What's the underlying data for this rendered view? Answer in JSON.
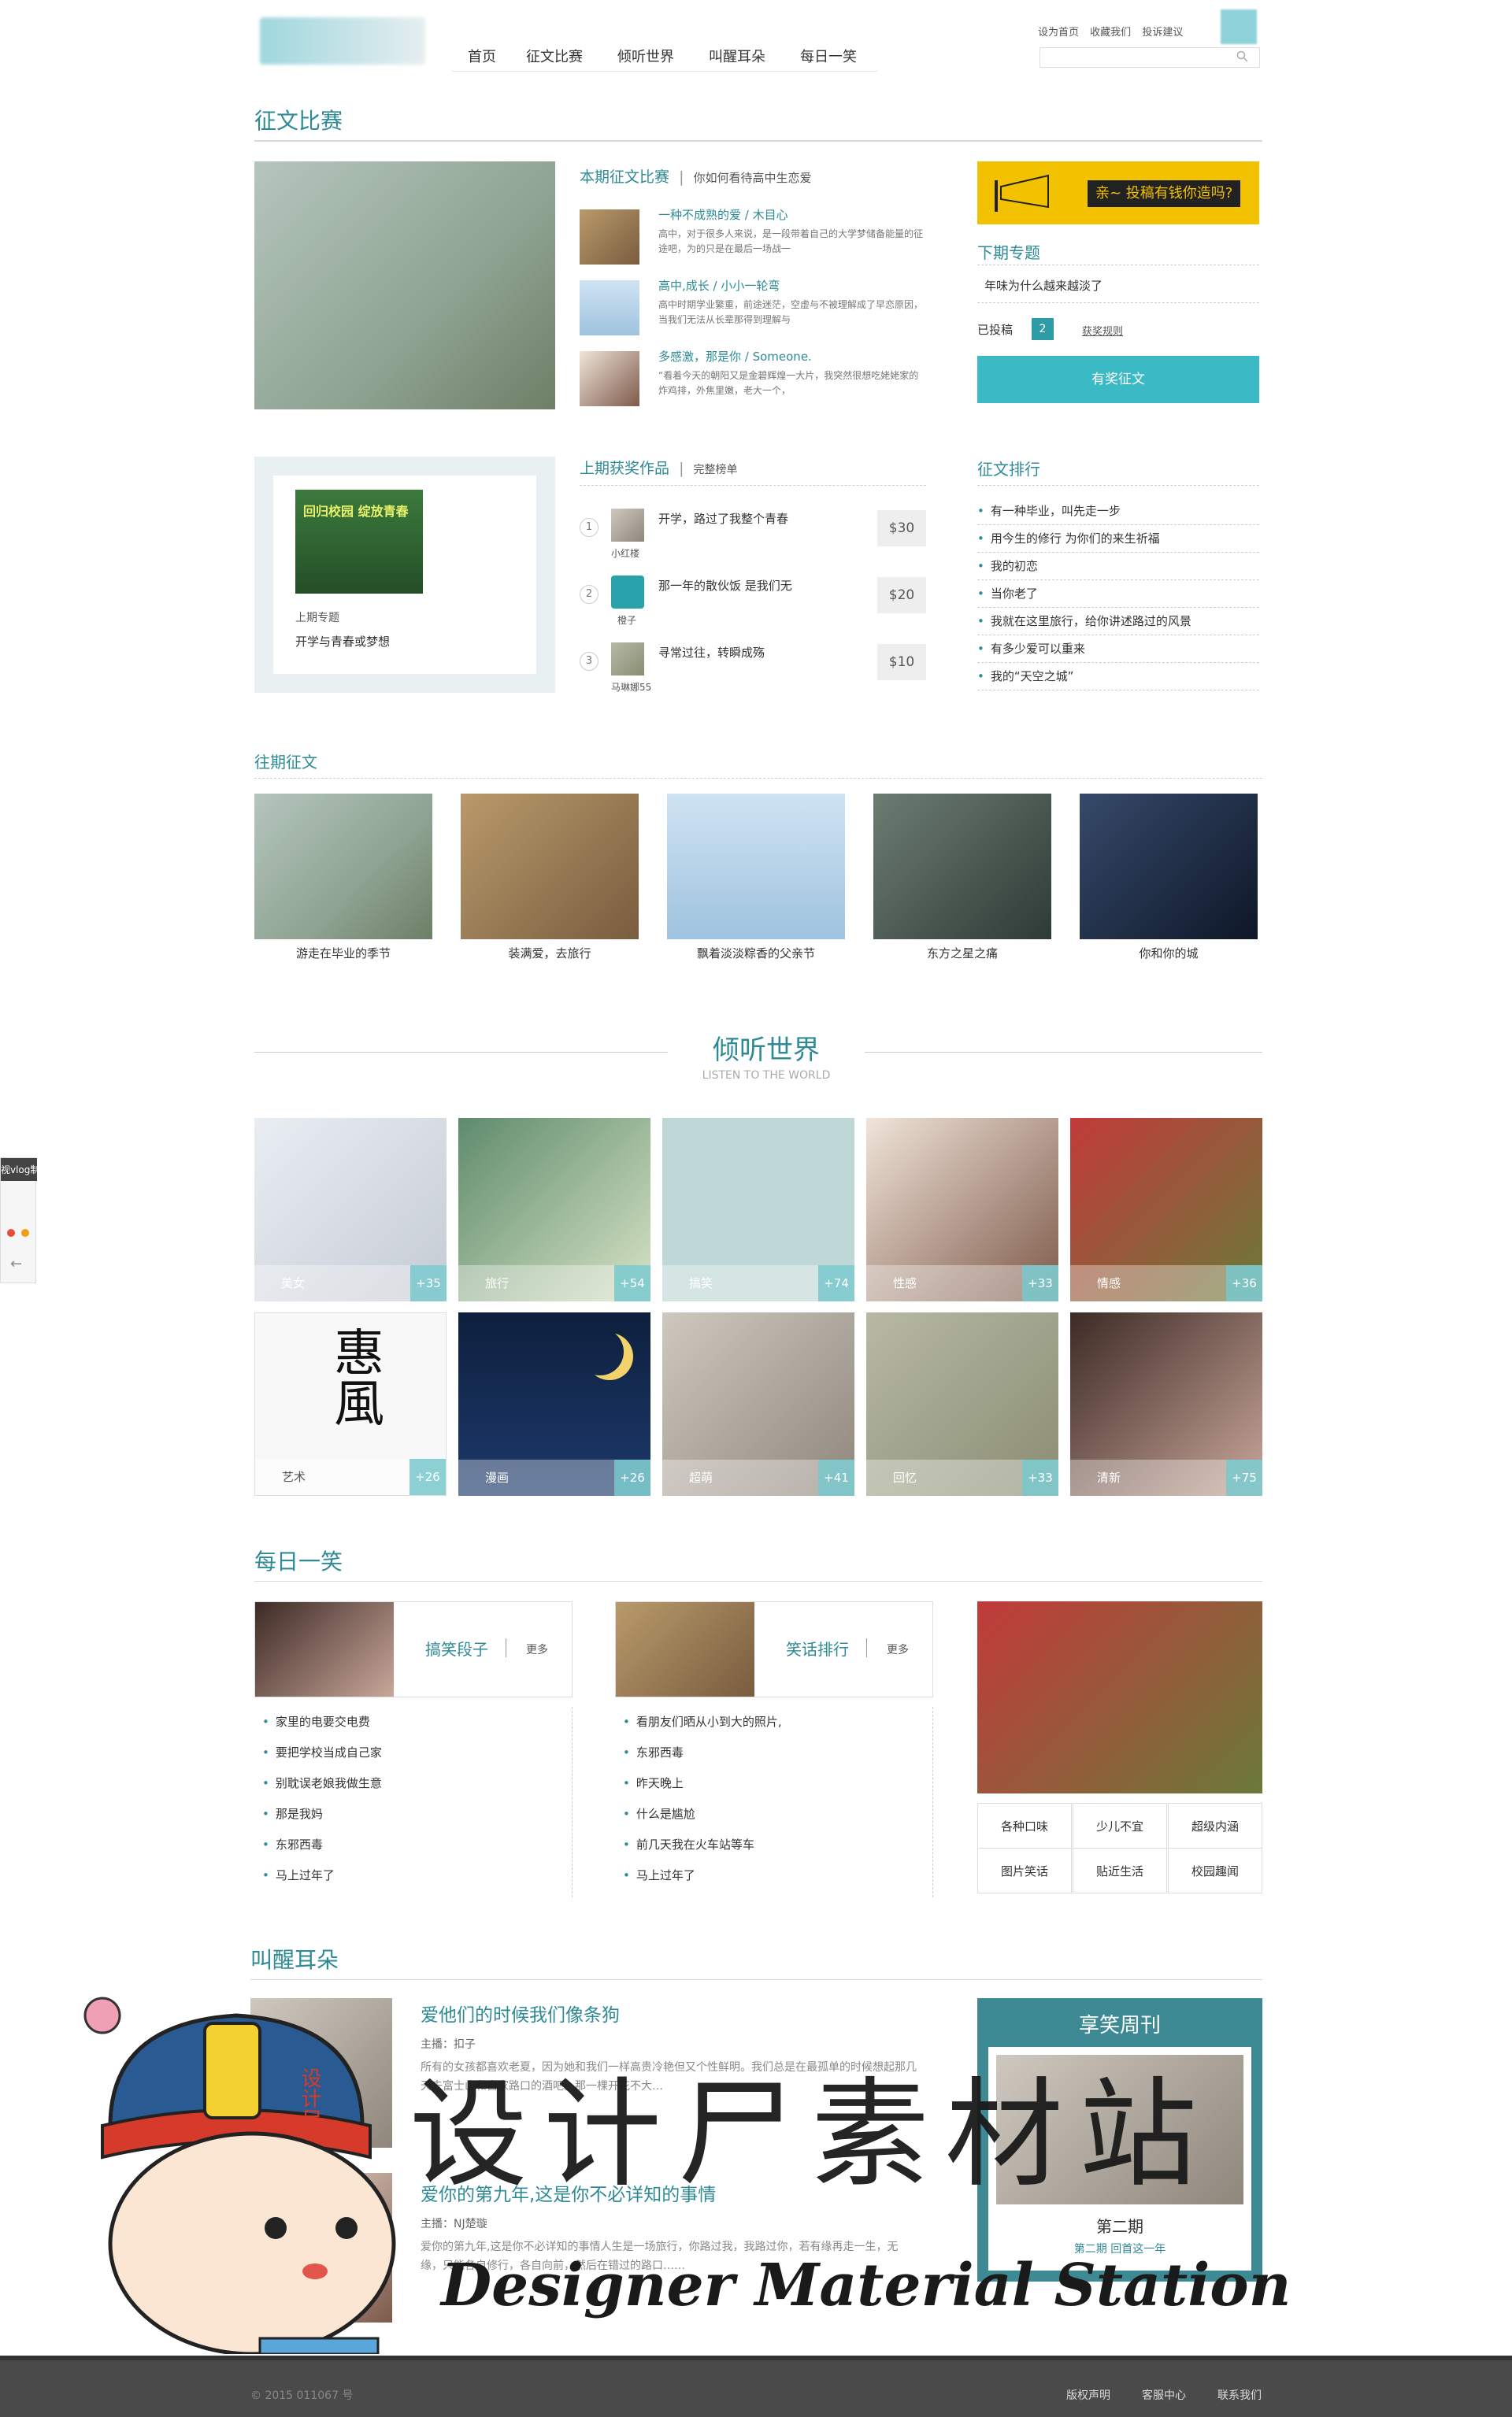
{
  "header": {
    "nav": [
      "首页",
      "征文比赛",
      "倾听世界",
      "叫醒耳朵",
      "每日一笑"
    ],
    "top_links": [
      "设为首页",
      "收藏我们",
      "投诉建议"
    ],
    "search_placeholder": ""
  },
  "contest": {
    "section_title": "征文比赛",
    "current_title": "本期征文比赛",
    "current_sub": "你如何看待高中生恋爱",
    "entries": [
      {
        "title": "一种不成熟的爱 / 木目心",
        "desc": "高中，对于很多人来说，是一段带着自己的大学梦储备能量的征途吧，为的只是在最后一场战一"
      },
      {
        "title": "高中,成长 / 小小一轮弯",
        "desc": "高中时期学业繁重，前途迷茫，空虚与不被理解成了早恋原因，当我们无法从长辈那得到理解与"
      },
      {
        "title": "多感激，那是你 / Someone.",
        "desc": "“看着今天的朝阳又是金碧辉煌一大片，我突然很想吃姥姥家的炸鸡排，外焦里嫩，老大一个，"
      }
    ],
    "banner_text": "亲~ 投稿有钱你造吗?",
    "next_title": "下期专题",
    "next_topic": "年味为什么越来越淡了",
    "submitted_label": "已投稿",
    "submitted_count": "2",
    "rules_link": "获奖规则",
    "cta": "有奖征文",
    "last_topic_label": "上期专题",
    "last_topic": "开学与青春或梦想",
    "poster_text": "回归校园 绽放青春",
    "award_title": "上期获奖作品",
    "award_sub": "完整榜单",
    "awards": [
      {
        "rank": "1",
        "title": "开学，路过了我整个青春",
        "author": "小红楼",
        "price": "$30"
      },
      {
        "rank": "2",
        "title": "那一年的散伙饭 是我们无",
        "author": "橙子",
        "price": "$20"
      },
      {
        "rank": "3",
        "title": "寻常过往，转瞬成殇",
        "author": "马琳娜55",
        "price": "$10"
      }
    ],
    "ranking_title": "征文排行",
    "ranking": [
      "有一种毕业，叫先走一步",
      "用今生的修行 为你们的来生祈福",
      "我的初恋",
      "当你老了",
      "我就在这里旅行，给你讲述路过的风景",
      "有多少爱可以重来",
      "我的“天空之城”"
    ],
    "past_title": "往期征文",
    "past": [
      "游走在毕业的季节",
      "装满爱，去旅行",
      "飘着淡淡粽香的父亲节",
      "东方之星之痛",
      "你和你的城"
    ]
  },
  "listen": {
    "title": "倾听世界",
    "subtitle": "LISTEN TO THE WORLD",
    "tiles": [
      {
        "label": "美女",
        "count": "+35"
      },
      {
        "label": "旅行",
        "count": "+54"
      },
      {
        "label": "搞笑",
        "count": "+74"
      },
      {
        "label": "性感",
        "count": "+33"
      },
      {
        "label": "情感",
        "count": "+36"
      },
      {
        "label": "艺术",
        "count": "+26"
      },
      {
        "label": "漫画",
        "count": "+26"
      },
      {
        "label": "超萌",
        "count": "+41"
      },
      {
        "label": "回忆",
        "count": "+33"
      },
      {
        "label": "清新",
        "count": "+75"
      }
    ]
  },
  "laugh": {
    "title": "每日一笑",
    "col1_title": "搞笑段子",
    "col2_title": "笑话排行",
    "more": "更多",
    "col1": [
      "家里的电要交电费",
      "要把学校当成自己家",
      "别耽误老娘我做生意",
      "那是我妈",
      "东邪西毒",
      "马上过年了"
    ],
    "col2": [
      "看朋友们晒从小到大的照片,",
      "东邪西毒",
      "昨天晚上",
      "什么是尴尬",
      "前几天我在火车站等车",
      "马上过年了"
    ],
    "grid": [
      "各种口味",
      "少儿不宜",
      "超级内涵",
      "图片笑话",
      "贴近生活",
      "校园趣闻"
    ]
  },
  "ears": {
    "title": "叫醒耳朵",
    "items": [
      {
        "title": "爱他们的时候我们像条狗",
        "host": "主播：扣子",
        "desc": "所有的女孩都喜欢老夏，因为她和我们一样高贵冷艳但又个性鲜明。我们总是在最孤单的时候想起那几天去富士山和自家路口的酒吧。那一棵开花不大…"
      },
      {
        "title": "爱你的第九年,这是你不必详知的事情",
        "host": "主播：NJ楚璇",
        "desc": "爱你的第九年,这是你不必详知的事情人生是一场旅行，你路过我，我路过你，若有缘再走一生，无缘，只能各自修行，各自向前，然后在错过的路口……"
      }
    ],
    "weekly_title": "享笑周刊",
    "issue": "第二期",
    "issue_desc": "第二期 回首这一年"
  },
  "watermark": {
    "cn": "设计尸素材站",
    "en": "Designer Material Station",
    "badge": "设计尸"
  },
  "footer": {
    "copyright": "© 2015 011067 号",
    "links": [
      "版权声明",
      "客服中心",
      "联系我们"
    ]
  },
  "sidewidget": {
    "label": "视vlog制"
  }
}
